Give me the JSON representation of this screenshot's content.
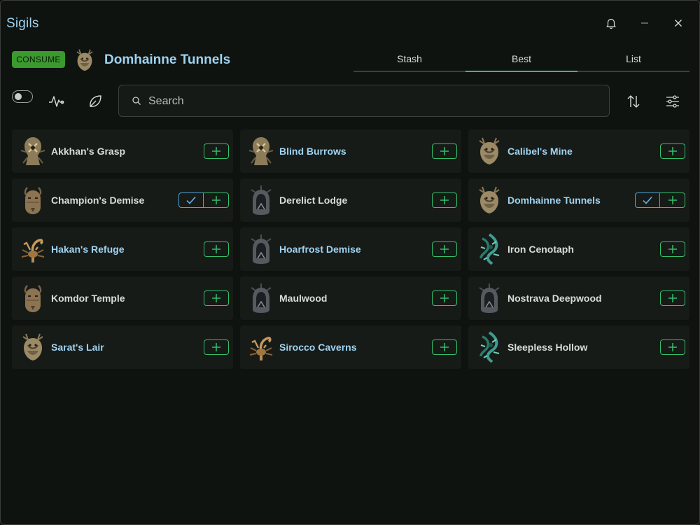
{
  "app": {
    "title": "Sigils"
  },
  "window_controls": {
    "icons": [
      "bell-icon",
      "minimize-icon",
      "close-icon"
    ]
  },
  "header": {
    "badge": "CONSUME",
    "zone_title": "Domhainne Tunnels",
    "zone_sigil": "stag"
  },
  "tabs": [
    {
      "label": "Stash",
      "active": false
    },
    {
      "label": "Best",
      "active": true
    },
    {
      "label": "List",
      "active": false
    }
  ],
  "toolbar": {
    "toggle_on": false,
    "search_placeholder": "Search",
    "icons": [
      "pulse-icon",
      "leaf-icon",
      "sort-icon",
      "filter-sliders-icon"
    ]
  },
  "colors": {
    "accent_green": "#34c06a",
    "accent_blue": "#9fd3f0",
    "badge_green": "#3a9a2e",
    "check_blue": "#4fa5d8"
  },
  "sigils": [
    {
      "name": "Akkhan's Grasp",
      "highlight": false,
      "checked": false,
      "icon": "bone"
    },
    {
      "name": "Blind Burrows",
      "highlight": true,
      "checked": false,
      "icon": "bone"
    },
    {
      "name": "Calibel's Mine",
      "highlight": true,
      "checked": false,
      "icon": "stag"
    },
    {
      "name": "Champion's Demise",
      "highlight": false,
      "checked": true,
      "icon": "goat"
    },
    {
      "name": "Derelict Lodge",
      "highlight": false,
      "checked": false,
      "icon": "hood"
    },
    {
      "name": "Domhainne Tunnels",
      "highlight": true,
      "checked": true,
      "icon": "stag"
    },
    {
      "name": "Hakan's Refuge",
      "highlight": true,
      "checked": false,
      "icon": "scorpion"
    },
    {
      "name": "Hoarfrost Demise",
      "highlight": true,
      "checked": false,
      "icon": "hood"
    },
    {
      "name": "Iron Cenotaph",
      "highlight": false,
      "checked": false,
      "icon": "vine"
    },
    {
      "name": "Komdor Temple",
      "highlight": false,
      "checked": false,
      "icon": "goat"
    },
    {
      "name": "Maulwood",
      "highlight": false,
      "checked": false,
      "icon": "hood"
    },
    {
      "name": "Nostrava Deepwood",
      "highlight": false,
      "checked": false,
      "icon": "hood"
    },
    {
      "name": "Sarat's Lair",
      "highlight": true,
      "checked": false,
      "icon": "stag"
    },
    {
      "name": "Sirocco Caverns",
      "highlight": true,
      "checked": false,
      "icon": "scorpion"
    },
    {
      "name": "Sleepless Hollow",
      "highlight": false,
      "checked": false,
      "icon": "vine"
    }
  ]
}
